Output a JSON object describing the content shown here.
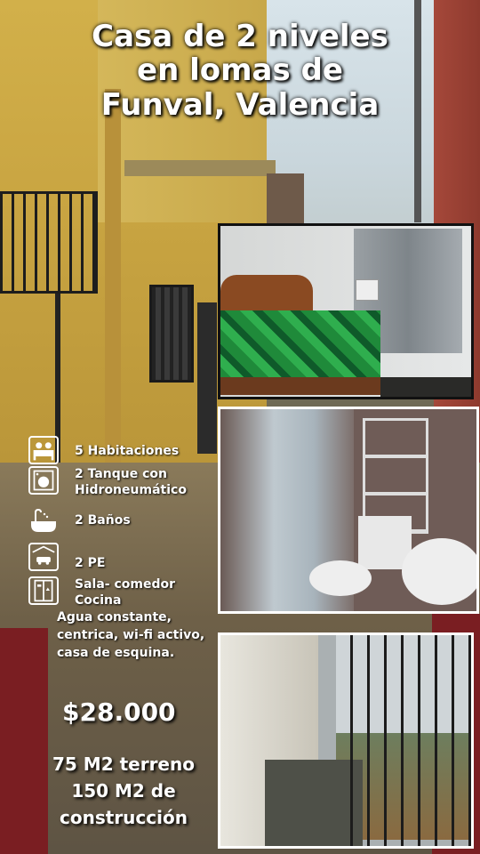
{
  "title": {
    "line1": "Casa de 2 niveles",
    "line2": "en lomas de",
    "line3": "Funval, Valencia"
  },
  "features": [
    {
      "icon": "bed-icon",
      "label": "5 Habitaciones"
    },
    {
      "icon": "washing-machine-icon",
      "label": "2 Tanque con",
      "label2": "Hidroneumático"
    },
    {
      "icon": "bathtub-icon",
      "label": "2 Baños"
    },
    {
      "icon": "garage-car-icon",
      "label": "2 PE"
    },
    {
      "icon": "kitchen-icon",
      "label": "Sala- comedor",
      "label2": "Cocina"
    }
  ],
  "description": "Agua constante, centrica, wi-fi activo, casa de esquina.",
  "price": "$28.000",
  "area": {
    "land": "75  M2  terreno",
    "built_line1": "150 M2 de",
    "built_line2": "construcción"
  },
  "colors": {
    "accent_red": "#7a1e22",
    "text": "#ffffff"
  }
}
